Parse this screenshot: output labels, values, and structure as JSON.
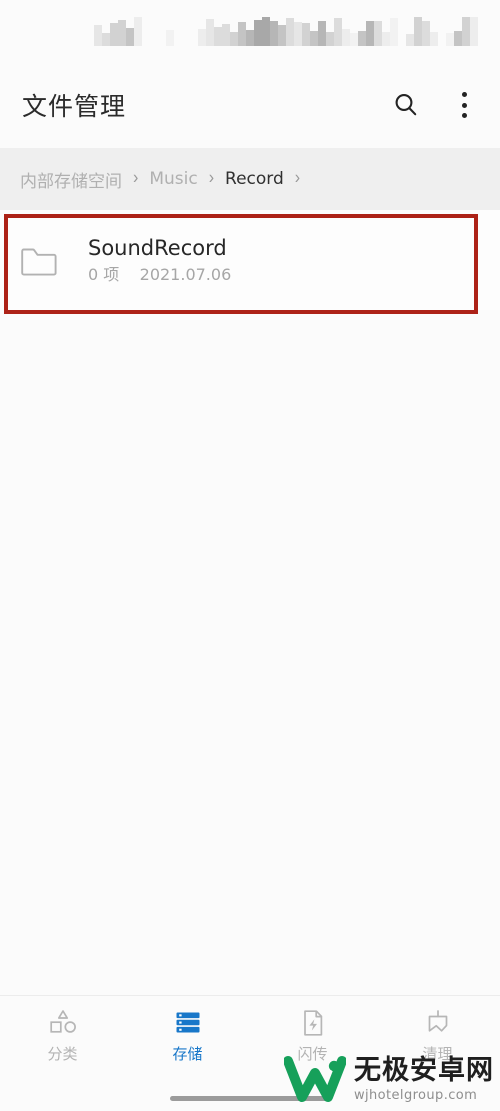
{
  "colors": {
    "accent_blue": "#1877c9",
    "annotation_red": "#ad2318",
    "breadcrumb_bg": "#efefef",
    "page_bg": "#fbfbfb",
    "text_primary": "#272727",
    "text_muted": "#a6a6a6",
    "watermark_green": "#16a05a"
  },
  "status_bar": {
    "censored": "mosaic-blurred status bar"
  },
  "header": {
    "title": "文件管理",
    "search_icon": "search-icon",
    "overflow_icon": "more-vertical-icon"
  },
  "breadcrumb": {
    "separator": "›",
    "items": [
      {
        "label": "内部存储空间",
        "active": false
      },
      {
        "label": "Music",
        "active": false
      },
      {
        "label": "Record",
        "active": true
      }
    ]
  },
  "file_list": {
    "items": [
      {
        "icon": "folder-icon",
        "name": "SoundRecord",
        "count": "0 项",
        "date": "2021.07.06",
        "highlighted": true
      }
    ]
  },
  "bottom_nav": {
    "items": [
      {
        "label": "分类",
        "icon": "shapes-icon",
        "active": false
      },
      {
        "label": "存储",
        "icon": "storage-stack-icon",
        "active": true
      },
      {
        "label": "闪传",
        "icon": "file-bolt-icon",
        "active": false
      },
      {
        "label": "清理",
        "icon": "broom-icon",
        "active": false
      }
    ]
  },
  "watermark": {
    "logo": "w-logo-icon",
    "title": "无极安卓网",
    "url": "wjhotelgroup.com"
  }
}
